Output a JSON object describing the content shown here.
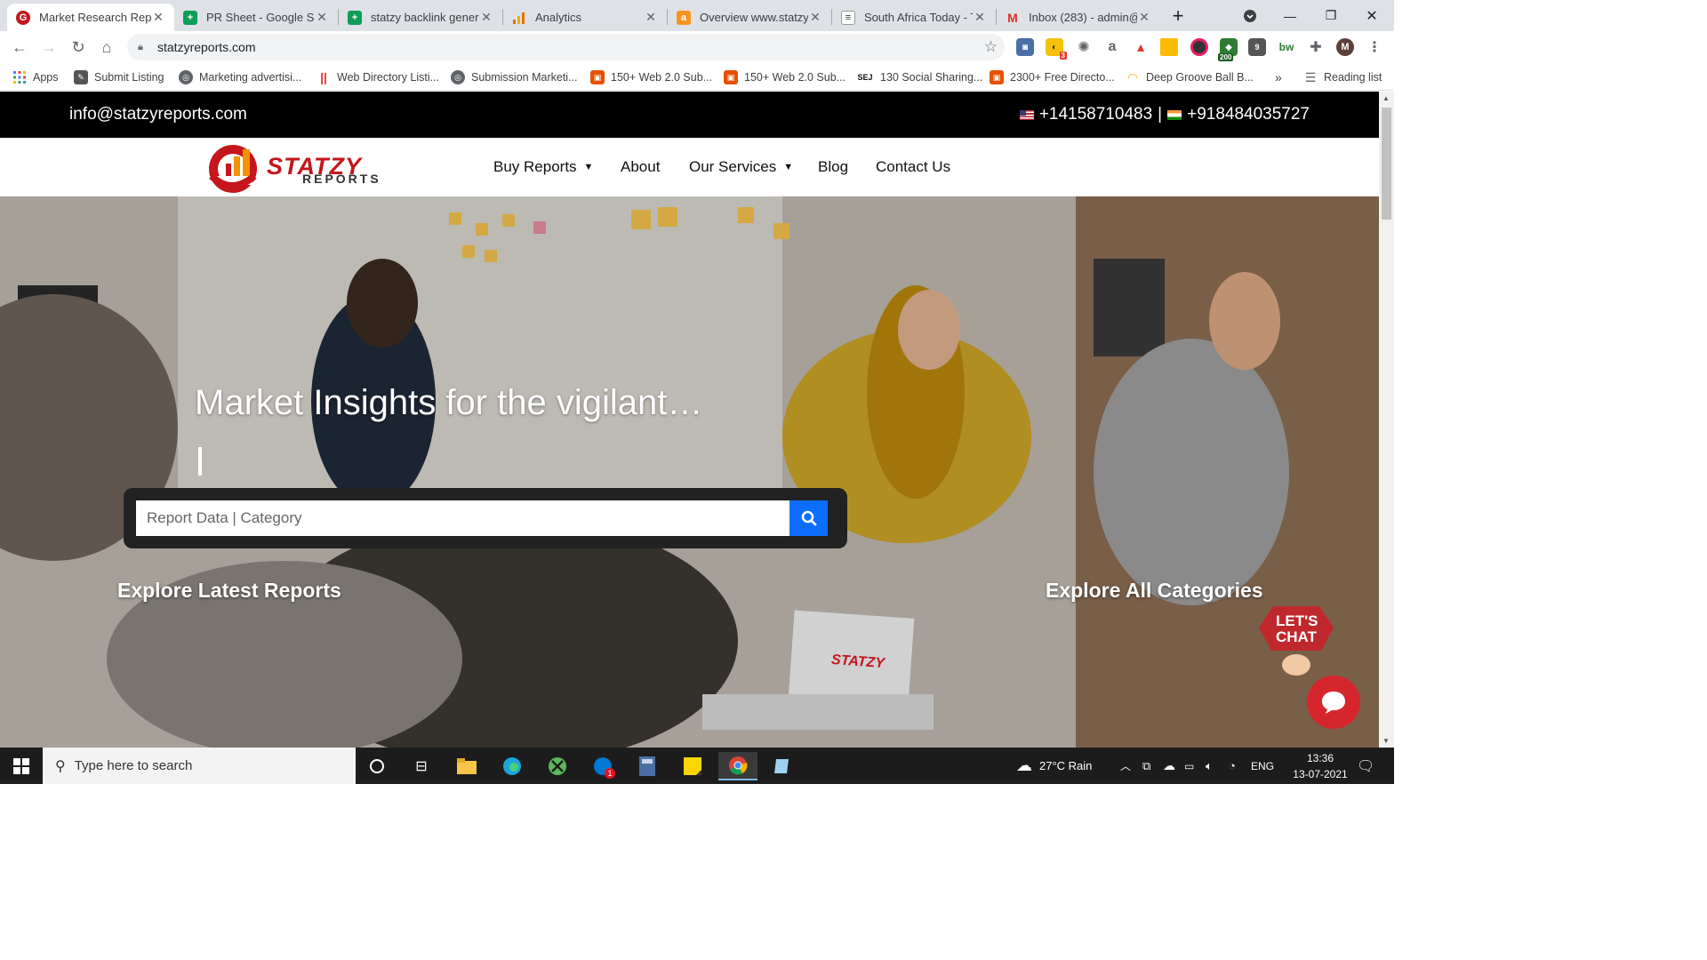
{
  "browser": {
    "tabs": [
      {
        "title": "Market Research Repc",
        "active": true,
        "icon": "statzy-favicon"
      },
      {
        "title": "PR Sheet - Google Sh",
        "active": false,
        "icon": "google-sheets-icon"
      },
      {
        "title": "statzy backlink genera",
        "active": false,
        "icon": "google-sheets-icon"
      },
      {
        "title": "Analytics",
        "active": false,
        "icon": "analytics-icon"
      },
      {
        "title": "Overview www.statzyr",
        "active": false,
        "icon": "ahrefs-icon"
      },
      {
        "title": "South Africa Today - T",
        "active": false,
        "icon": "news-icon"
      },
      {
        "title": "Inbox (283) - admin@",
        "active": false,
        "icon": "gmail-icon"
      }
    ],
    "url": "statzyreports.com",
    "profile_initial": "M",
    "extension_badges": {
      "badge_a": "3",
      "badge_b": "200",
      "badge_c": "9",
      "bw": "bw"
    }
  },
  "bookmarks": [
    {
      "label": "Apps",
      "icon": "apps-grid-icon"
    },
    {
      "label": "Submit Listing",
      "icon": "submit-icon"
    },
    {
      "label": "Marketing advertisi...",
      "icon": "globe-icon"
    },
    {
      "label": "Web Directory Listi...",
      "icon": "directory-icon"
    },
    {
      "label": "Submission Marketi...",
      "icon": "globe-icon"
    },
    {
      "label": "150+ Web 2.0 Sub...",
      "icon": "web20-icon"
    },
    {
      "label": "150+ Web 2.0 Sub...",
      "icon": "web20-icon"
    },
    {
      "label": "130 Social Sharing...",
      "icon": "sej-icon"
    },
    {
      "label": "2300+ Free Directo...",
      "icon": "web20-icon"
    },
    {
      "label": "Deep Groove Ball B...",
      "icon": "bearing-icon"
    }
  ],
  "bookmarks_more": "»",
  "reading_list": "Reading list",
  "site": {
    "email": "info@statzyreports.com",
    "phone_us": "+14158710483",
    "phone_sep": "|",
    "phone_in": "+918484035727",
    "logo_main": "STATZY",
    "logo_sub": "REPORTS",
    "nav": [
      {
        "label": "Buy Reports",
        "dropdown": true
      },
      {
        "label": "About",
        "dropdown": false
      },
      {
        "label": "Our Services",
        "dropdown": true
      },
      {
        "label": "Blog",
        "dropdown": false
      },
      {
        "label": "Contact Us",
        "dropdown": false
      }
    ],
    "hero_title": "Market Insights for the vigilant…",
    "search_placeholder": "Report Data | Category",
    "explore_latest": "Explore Latest Reports",
    "explore_all": "Explore All Categories",
    "lets_chat_line1": "LET'S",
    "lets_chat_line2": "CHAT",
    "laptop_logo": "STATZY"
  },
  "taskbar": {
    "search_placeholder": "Type here to search",
    "weather": "27°C  Rain",
    "language": "ENG",
    "time": "13:36",
    "date": "13-07-2021",
    "skype_badge": "1"
  },
  "colors": {
    "brand_red": "#c4161c",
    "search_button": "#0d6efd",
    "topbar_bg": "#000000"
  }
}
